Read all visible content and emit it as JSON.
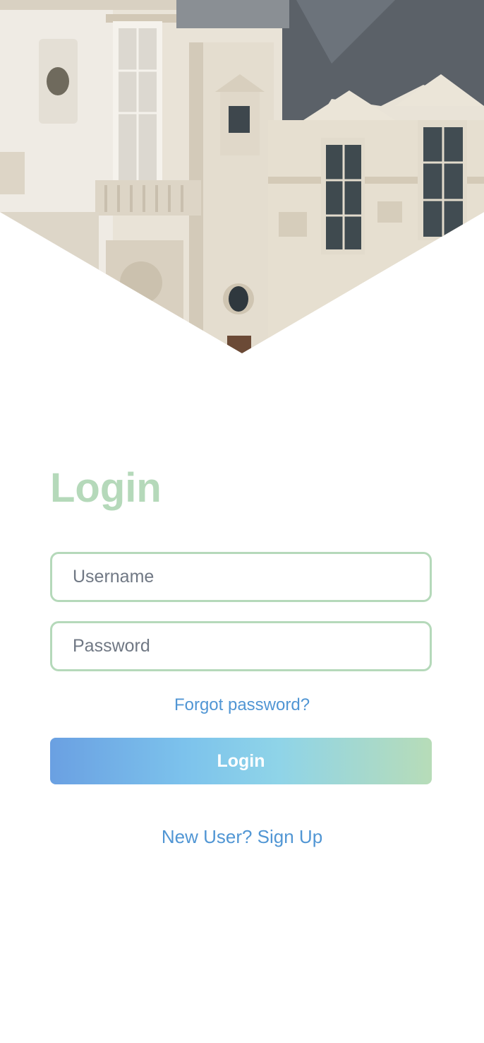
{
  "hero": {
    "image": "building-facade-photo"
  },
  "login": {
    "title": "Login",
    "username_placeholder": "Username",
    "password_placeholder": "Password",
    "forgot_label": "Forgot password?",
    "button_label": "Login",
    "signup_label": "New User? Sign Up"
  },
  "colors": {
    "accent_green": "#b5d9ba",
    "link_blue": "#5196d4",
    "gradient_start": "#6aa0e2",
    "gradient_end": "#b7dcb8"
  }
}
